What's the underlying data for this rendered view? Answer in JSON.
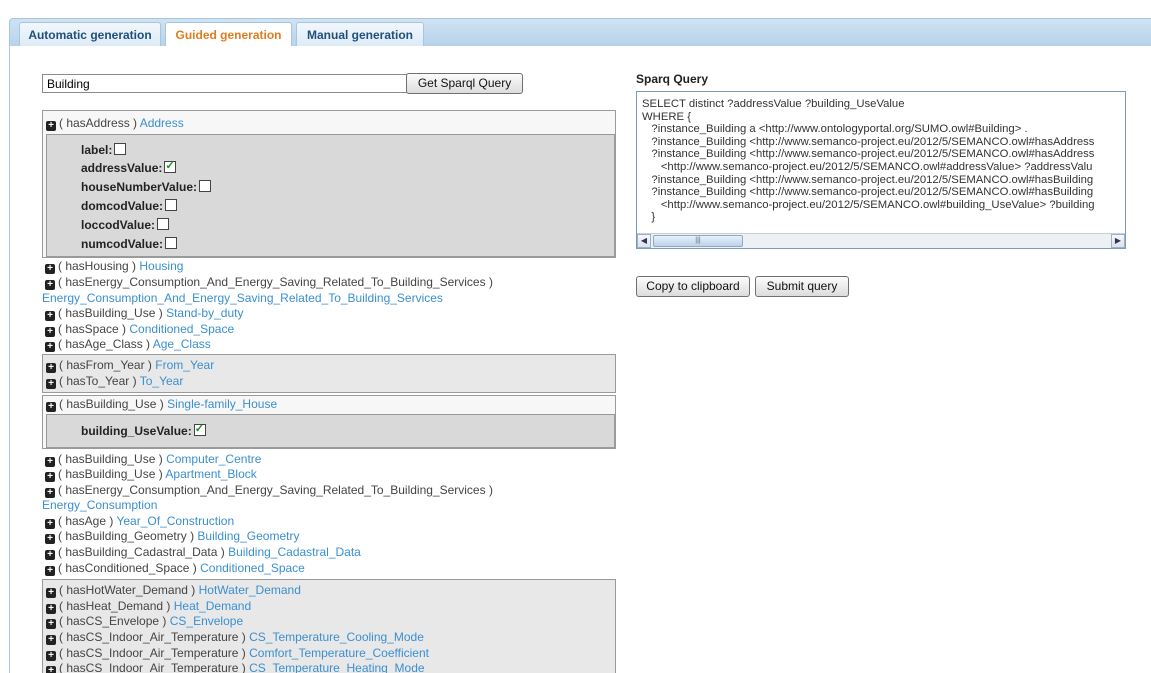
{
  "tabs": [
    {
      "label": "Automatic generation"
    },
    {
      "label": "Guided generation"
    },
    {
      "label": "Manual generation"
    }
  ],
  "search": {
    "value": "Building",
    "button": "Get Sparql Query"
  },
  "tree": {
    "address": {
      "prop": "( hasAddress )",
      "link": "Address"
    },
    "address_attrs": [
      {
        "label": "label:",
        "checked": false
      },
      {
        "label": "addressValue:",
        "checked": true
      },
      {
        "label": "houseNumberValue:",
        "checked": false
      },
      {
        "label": "domcodValue:",
        "checked": false
      },
      {
        "label": "loccodValue:",
        "checked": false
      },
      {
        "label": "numcodValue:",
        "checked": false
      }
    ],
    "block1": [
      {
        "prop": "( hasHousing )",
        "link": "Housing"
      },
      {
        "prop": "( hasEnergy_Consumption_And_Energy_Saving_Related_To_Building_Services )",
        "link": ""
      },
      {
        "prop": "",
        "link": "Energy_Consumption_And_Energy_Saving_Related_To_Building_Services"
      },
      {
        "prop": "( hasBuilding_Use )",
        "link": "Stand-by_duty"
      },
      {
        "prop": "( hasSpace )",
        "link": "Conditioned_Space"
      },
      {
        "prop": "( hasAge_Class )",
        "link": "Age_Class"
      }
    ],
    "block2": [
      {
        "prop": "( hasFrom_Year )",
        "link": "From_Year"
      },
      {
        "prop": "( hasTo_Year )",
        "link": "To_Year"
      }
    ],
    "single_family": {
      "prop": "( hasBuilding_Use )",
      "link": "Single-family_House"
    },
    "use_attr": {
      "label": "building_UseValue:",
      "checked": true
    },
    "block3": [
      {
        "prop": "( hasBuilding_Use )",
        "link": "Computer_Centre"
      },
      {
        "prop": "( hasBuilding_Use )",
        "link": "Apartment_Block"
      },
      {
        "prop": "( hasEnergy_Consumption_And_Energy_Saving_Related_To_Building_Services )",
        "link": ""
      },
      {
        "prop": "",
        "link": "Energy_Consumption"
      },
      {
        "prop": "( hasAge )",
        "link": "Year_Of_Construction"
      },
      {
        "prop": "( hasBuilding_Geometry )",
        "link": "Building_Geometry"
      },
      {
        "prop": "( hasBuilding_Cadastral_Data )",
        "link": "Building_Cadastral_Data"
      },
      {
        "prop": "( hasConditioned_Space )",
        "link": "Conditioned_Space"
      }
    ],
    "block4": [
      {
        "prop": "( hasHotWater_Demand )",
        "link": "HotWater_Demand"
      },
      {
        "prop": "( hasHeat_Demand )",
        "link": "Heat_Demand"
      },
      {
        "prop": "( hasCS_Envelope )",
        "link": "CS_Envelope"
      },
      {
        "prop": "( hasCS_Indoor_Air_Temperature )",
        "link": "CS_Temperature_Cooling_Mode"
      },
      {
        "prop": "( hasCS_Indoor_Air_Temperature )",
        "link": "Comfort_Temperature_Coefficient"
      },
      {
        "prop": "( hasCS_Indoor_Air_Temperature )",
        "link": "CS_Temperature_Heating_Mode"
      }
    ]
  },
  "sparql": {
    "label": "Sparq Query",
    "lines": [
      "SELECT distinct ?addressValue ?building_UseValue",
      "WHERE {",
      "   ?instance_Building a <http://www.ontologyportal.org/SUMO.owl#Building> .",
      "   ?instance_Building <http://www.semanco-project.eu/2012/5/SEMANCO.owl#hasAddress",
      "   ?instance_Building <http://www.semanco-project.eu/2012/5/SEMANCO.owl#hasAddress",
      "      <http://www.semanco-project.eu/2012/5/SEMANCO.owl#addressValue> ?addressValu",
      "   ?instance_Building <http://www.semanco-project.eu/2012/5/SEMANCO.owl#hasBuilding",
      "   ?instance_Building <http://www.semanco-project.eu/2012/5/SEMANCO.owl#hasBuilding",
      "      <http://www.semanco-project.eu/2012/5/SEMANCO.owl#building_UseValue> ?building",
      "   }"
    ],
    "copy_button": "Copy to clipboard",
    "submit_button": "Submit query"
  }
}
